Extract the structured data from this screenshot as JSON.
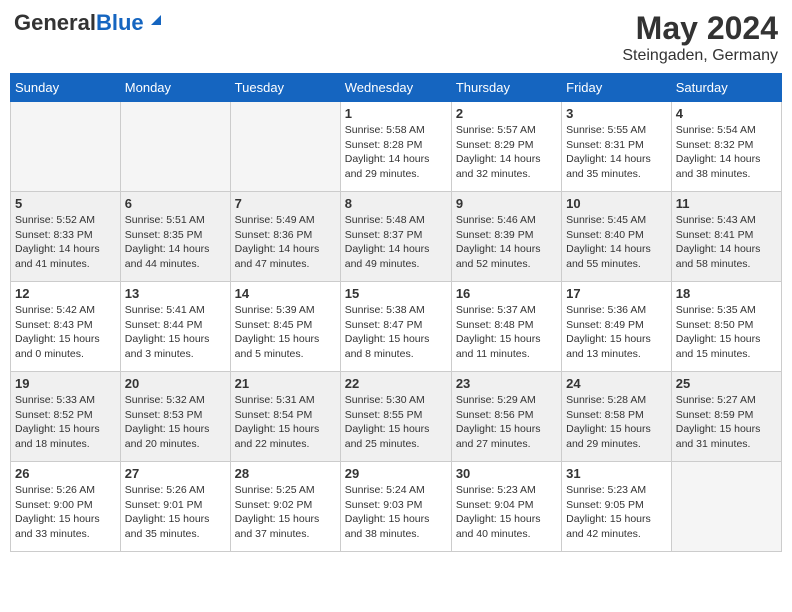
{
  "header": {
    "logo_general": "General",
    "logo_blue": "Blue",
    "month_title": "May 2024",
    "location": "Steingaden, Germany"
  },
  "days_of_week": [
    "Sunday",
    "Monday",
    "Tuesday",
    "Wednesday",
    "Thursday",
    "Friday",
    "Saturday"
  ],
  "weeks": [
    [
      {
        "day": "",
        "info": ""
      },
      {
        "day": "",
        "info": ""
      },
      {
        "day": "",
        "info": ""
      },
      {
        "day": "1",
        "info": "Sunrise: 5:58 AM\nSunset: 8:28 PM\nDaylight: 14 hours\nand 29 minutes."
      },
      {
        "day": "2",
        "info": "Sunrise: 5:57 AM\nSunset: 8:29 PM\nDaylight: 14 hours\nand 32 minutes."
      },
      {
        "day": "3",
        "info": "Sunrise: 5:55 AM\nSunset: 8:31 PM\nDaylight: 14 hours\nand 35 minutes."
      },
      {
        "day": "4",
        "info": "Sunrise: 5:54 AM\nSunset: 8:32 PM\nDaylight: 14 hours\nand 38 minutes."
      }
    ],
    [
      {
        "day": "5",
        "info": "Sunrise: 5:52 AM\nSunset: 8:33 PM\nDaylight: 14 hours\nand 41 minutes."
      },
      {
        "day": "6",
        "info": "Sunrise: 5:51 AM\nSunset: 8:35 PM\nDaylight: 14 hours\nand 44 minutes."
      },
      {
        "day": "7",
        "info": "Sunrise: 5:49 AM\nSunset: 8:36 PM\nDaylight: 14 hours\nand 47 minutes."
      },
      {
        "day": "8",
        "info": "Sunrise: 5:48 AM\nSunset: 8:37 PM\nDaylight: 14 hours\nand 49 minutes."
      },
      {
        "day": "9",
        "info": "Sunrise: 5:46 AM\nSunset: 8:39 PM\nDaylight: 14 hours\nand 52 minutes."
      },
      {
        "day": "10",
        "info": "Sunrise: 5:45 AM\nSunset: 8:40 PM\nDaylight: 14 hours\nand 55 minutes."
      },
      {
        "day": "11",
        "info": "Sunrise: 5:43 AM\nSunset: 8:41 PM\nDaylight: 14 hours\nand 58 minutes."
      }
    ],
    [
      {
        "day": "12",
        "info": "Sunrise: 5:42 AM\nSunset: 8:43 PM\nDaylight: 15 hours\nand 0 minutes."
      },
      {
        "day": "13",
        "info": "Sunrise: 5:41 AM\nSunset: 8:44 PM\nDaylight: 15 hours\nand 3 minutes."
      },
      {
        "day": "14",
        "info": "Sunrise: 5:39 AM\nSunset: 8:45 PM\nDaylight: 15 hours\nand 5 minutes."
      },
      {
        "day": "15",
        "info": "Sunrise: 5:38 AM\nSunset: 8:47 PM\nDaylight: 15 hours\nand 8 minutes."
      },
      {
        "day": "16",
        "info": "Sunrise: 5:37 AM\nSunset: 8:48 PM\nDaylight: 15 hours\nand 11 minutes."
      },
      {
        "day": "17",
        "info": "Sunrise: 5:36 AM\nSunset: 8:49 PM\nDaylight: 15 hours\nand 13 minutes."
      },
      {
        "day": "18",
        "info": "Sunrise: 5:35 AM\nSunset: 8:50 PM\nDaylight: 15 hours\nand 15 minutes."
      }
    ],
    [
      {
        "day": "19",
        "info": "Sunrise: 5:33 AM\nSunset: 8:52 PM\nDaylight: 15 hours\nand 18 minutes."
      },
      {
        "day": "20",
        "info": "Sunrise: 5:32 AM\nSunset: 8:53 PM\nDaylight: 15 hours\nand 20 minutes."
      },
      {
        "day": "21",
        "info": "Sunrise: 5:31 AM\nSunset: 8:54 PM\nDaylight: 15 hours\nand 22 minutes."
      },
      {
        "day": "22",
        "info": "Sunrise: 5:30 AM\nSunset: 8:55 PM\nDaylight: 15 hours\nand 25 minutes."
      },
      {
        "day": "23",
        "info": "Sunrise: 5:29 AM\nSunset: 8:56 PM\nDaylight: 15 hours\nand 27 minutes."
      },
      {
        "day": "24",
        "info": "Sunrise: 5:28 AM\nSunset: 8:58 PM\nDaylight: 15 hours\nand 29 minutes."
      },
      {
        "day": "25",
        "info": "Sunrise: 5:27 AM\nSunset: 8:59 PM\nDaylight: 15 hours\nand 31 minutes."
      }
    ],
    [
      {
        "day": "26",
        "info": "Sunrise: 5:26 AM\nSunset: 9:00 PM\nDaylight: 15 hours\nand 33 minutes."
      },
      {
        "day": "27",
        "info": "Sunrise: 5:26 AM\nSunset: 9:01 PM\nDaylight: 15 hours\nand 35 minutes."
      },
      {
        "day": "28",
        "info": "Sunrise: 5:25 AM\nSunset: 9:02 PM\nDaylight: 15 hours\nand 37 minutes."
      },
      {
        "day": "29",
        "info": "Sunrise: 5:24 AM\nSunset: 9:03 PM\nDaylight: 15 hours\nand 38 minutes."
      },
      {
        "day": "30",
        "info": "Sunrise: 5:23 AM\nSunset: 9:04 PM\nDaylight: 15 hours\nand 40 minutes."
      },
      {
        "day": "31",
        "info": "Sunrise: 5:23 AM\nSunset: 9:05 PM\nDaylight: 15 hours\nand 42 minutes."
      },
      {
        "day": "",
        "info": ""
      }
    ]
  ]
}
